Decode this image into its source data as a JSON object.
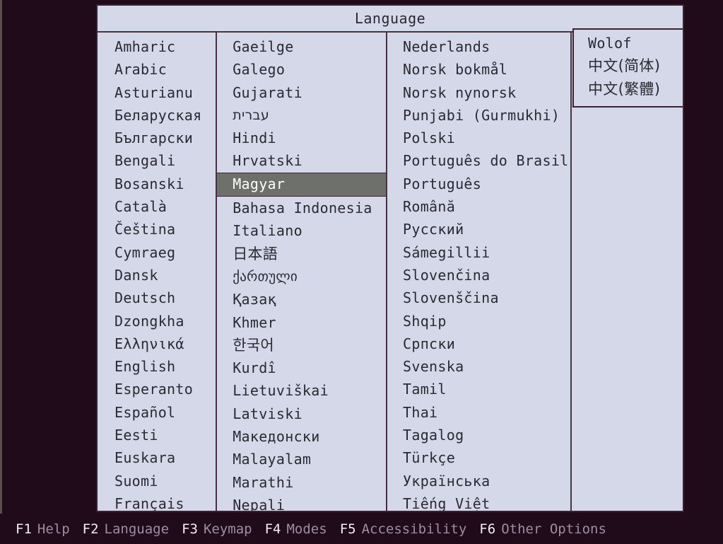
{
  "screen": {
    "background_color": "#200b1a",
    "panel_color": "#d4d8e8",
    "border_color": "#3a2230",
    "selection_color": "#6e706c",
    "text_color": "#2a2a33",
    "fkey_code_color": "#f2f0f4",
    "fkey_label_color": "#9b8ea3"
  },
  "dialog": {
    "title": "Language",
    "selected_language": "Magyar",
    "columns": [
      {
        "id": "col-0",
        "items": [
          {
            "label": "Amharic",
            "script": "latin"
          },
          {
            "label": "Arabic",
            "script": "latin"
          },
          {
            "label": "Asturianu",
            "script": "latin"
          },
          {
            "label": "Беларуская",
            "script": "cyrillic"
          },
          {
            "label": "Български",
            "script": "cyrillic"
          },
          {
            "label": "Bengali",
            "script": "latin"
          },
          {
            "label": "Bosanski",
            "script": "latin"
          },
          {
            "label": "Català",
            "script": "latin"
          },
          {
            "label": "Čeština",
            "script": "latin"
          },
          {
            "label": "Cymraeg",
            "script": "latin"
          },
          {
            "label": "Dansk",
            "script": "latin"
          },
          {
            "label": "Deutsch",
            "script": "latin"
          },
          {
            "label": "Dzongkha",
            "script": "latin"
          },
          {
            "label": "Ελληνικά",
            "script": "greek"
          },
          {
            "label": "English",
            "script": "latin"
          },
          {
            "label": "Esperanto",
            "script": "latin"
          },
          {
            "label": "Español",
            "script": "latin"
          },
          {
            "label": "Eesti",
            "script": "latin"
          },
          {
            "label": "Euskara",
            "script": "latin"
          },
          {
            "label": "Suomi",
            "script": "latin"
          },
          {
            "label": "Français",
            "script": "latin"
          }
        ]
      },
      {
        "id": "col-1",
        "items": [
          {
            "label": "Gaeilge",
            "script": "latin"
          },
          {
            "label": "Galego",
            "script": "latin"
          },
          {
            "label": "Gujarati",
            "script": "latin"
          },
          {
            "label": "עברית",
            "script": "hebrew"
          },
          {
            "label": "Hindi",
            "script": "latin"
          },
          {
            "label": "Hrvatski",
            "script": "latin"
          },
          {
            "label": "Magyar",
            "script": "latin"
          },
          {
            "label": "Bahasa Indonesia",
            "script": "latin"
          },
          {
            "label": "Italiano",
            "script": "latin"
          },
          {
            "label": "日本語",
            "script": "cjk"
          },
          {
            "label": "ქართული",
            "script": "georgian"
          },
          {
            "label": "Қазақ",
            "script": "cyrillic"
          },
          {
            "label": "Khmer",
            "script": "latin"
          },
          {
            "label": "한국어",
            "script": "cjk"
          },
          {
            "label": "Kurdî",
            "script": "latin"
          },
          {
            "label": "Lietuviškai",
            "script": "latin"
          },
          {
            "label": "Latviski",
            "script": "latin"
          },
          {
            "label": "Македонски",
            "script": "cyrillic"
          },
          {
            "label": "Malayalam",
            "script": "latin"
          },
          {
            "label": "Marathi",
            "script": "latin"
          },
          {
            "label": "Nepali",
            "script": "latin"
          }
        ]
      },
      {
        "id": "col-2",
        "items": [
          {
            "label": "Nederlands",
            "script": "latin"
          },
          {
            "label": "Norsk bokmål",
            "script": "latin"
          },
          {
            "label": "Norsk nynorsk",
            "script": "latin"
          },
          {
            "label": "Punjabi (Gurmukhi)",
            "script": "latin"
          },
          {
            "label": "Polski",
            "script": "latin"
          },
          {
            "label": "Português do Brasil",
            "script": "latin"
          },
          {
            "label": "Português",
            "script": "latin"
          },
          {
            "label": "Română",
            "script": "latin"
          },
          {
            "label": "Русский",
            "script": "cyrillic"
          },
          {
            "label": "Sámegillii",
            "script": "latin"
          },
          {
            "label": "Slovenčina",
            "script": "latin"
          },
          {
            "label": "Slovenščina",
            "script": "latin"
          },
          {
            "label": "Shqip",
            "script": "latin"
          },
          {
            "label": "Српски",
            "script": "cyrillic"
          },
          {
            "label": "Svenska",
            "script": "latin"
          },
          {
            "label": "Tamil",
            "script": "latin"
          },
          {
            "label": "Thai",
            "script": "latin"
          },
          {
            "label": "Tagalog",
            "script": "latin"
          },
          {
            "label": "Türkçe",
            "script": "latin"
          },
          {
            "label": "Українська",
            "script": "cyrillic"
          },
          {
            "label": "Tiếng Việt",
            "script": "latin"
          }
        ]
      },
      {
        "id": "col-3",
        "items": []
      }
    ],
    "overflow_column": {
      "items": [
        {
          "label": "Wolof",
          "script": "latin"
        },
        {
          "label": "中文(简体)",
          "script": "cjk"
        },
        {
          "label": "中文(繁體)",
          "script": "cjk"
        }
      ]
    }
  },
  "function_bar": {
    "keys": [
      {
        "code": "F1",
        "label": "Help"
      },
      {
        "code": "F2",
        "label": "Language"
      },
      {
        "code": "F3",
        "label": "Keymap"
      },
      {
        "code": "F4",
        "label": "Modes"
      },
      {
        "code": "F5",
        "label": "Accessibility"
      },
      {
        "code": "F6",
        "label": "Other Options"
      }
    ]
  }
}
